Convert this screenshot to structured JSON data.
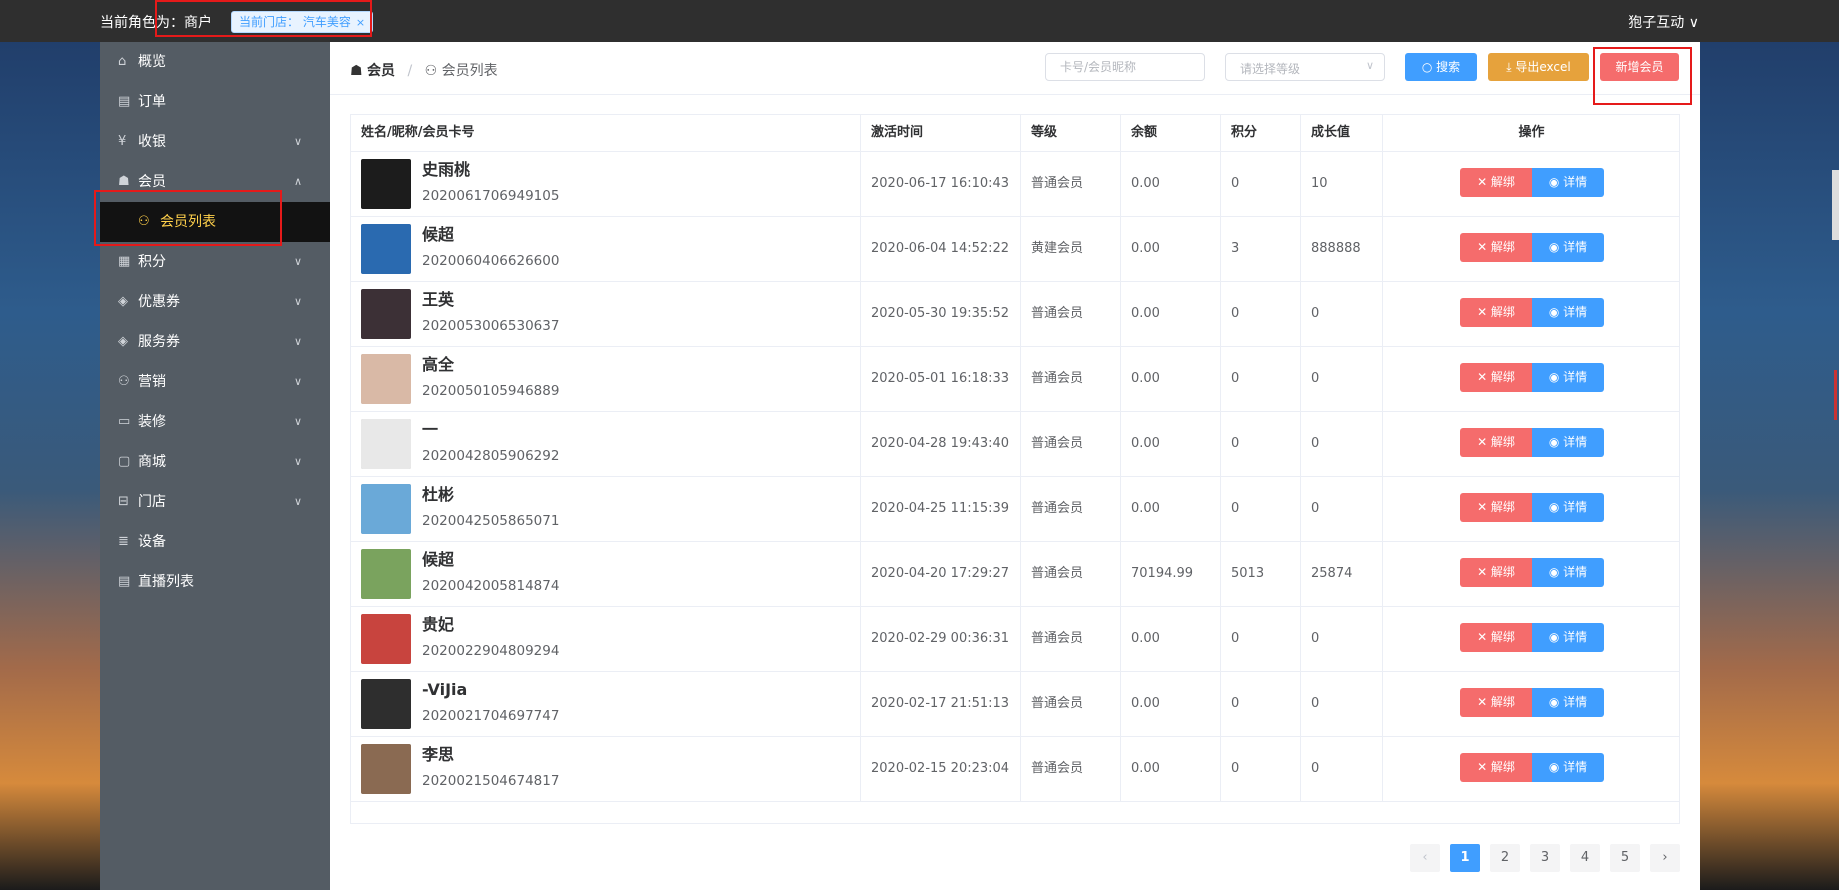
{
  "topbar": {
    "role_text": "当前角色为：商户",
    "store_tag": "当前门店： 汽车美容",
    "store_tag_close": "×",
    "user_menu": "狍子互动 ∨"
  },
  "sidebar": {
    "items": [
      {
        "label": "概览",
        "icon": "⌂",
        "chevron": ""
      },
      {
        "label": "订单",
        "icon": "▤",
        "chevron": ""
      },
      {
        "label": "收银",
        "icon": "¥",
        "chevron": "∨"
      },
      {
        "label": "会员",
        "icon": "☗",
        "chevron": "∧"
      },
      {
        "label": "积分",
        "icon": "▦",
        "chevron": "∨"
      },
      {
        "label": "优惠券",
        "icon": "◈",
        "chevron": "∨"
      },
      {
        "label": "服务券",
        "icon": "◈",
        "chevron": "∨"
      },
      {
        "label": "营销",
        "icon": "⚇",
        "chevron": "∨"
      },
      {
        "label": "装修",
        "icon": "▭",
        "chevron": "∨"
      },
      {
        "label": "商城",
        "icon": "▢",
        "chevron": "∨"
      },
      {
        "label": "门店",
        "icon": "⊟",
        "chevron": "∨"
      },
      {
        "label": "设备",
        "icon": "≣",
        "chevron": ""
      },
      {
        "label": "直播列表",
        "icon": "▤",
        "chevron": ""
      }
    ],
    "sub_item": {
      "label": "会员列表",
      "icon": "⚇"
    }
  },
  "breadcrumb": {
    "level1": "会员",
    "level2": "会员列表",
    "icon1": "☗",
    "icon2": "⚇",
    "separator": "/"
  },
  "search": {
    "card_placeholder": "卡号/会员昵称",
    "level_placeholder": "请选择等级",
    "level_arrow": "∨",
    "search_label": "搜索",
    "export_label": "导出excel",
    "add_label": "新增会员"
  },
  "table": {
    "columns": [
      "姓名/昵称/会员卡号",
      "激活时间",
      "等级",
      "余额",
      "积分",
      "成长值",
      "操作"
    ],
    "rows": [
      {
        "name": "史雨桃",
        "card": "2020061706949105",
        "time": "2020-06-17 16:10:43",
        "level": "普通会员",
        "balance": "0.00",
        "points": "0",
        "growth": "10",
        "avatar_color": "#1c1c1c"
      },
      {
        "name": "候超",
        "card": "2020060406626600",
        "time": "2020-06-04 14:52:22",
        "level": "黄建会员",
        "balance": "0.00",
        "points": "3",
        "growth": "888888",
        "avatar_color": "#2a6ab0"
      },
      {
        "name": "王英",
        "card": "2020053006530637",
        "time": "2020-05-30 19:35:52",
        "level": "普通会员",
        "balance": "0.00",
        "points": "0",
        "growth": "0",
        "avatar_color": "#3c3036"
      },
      {
        "name": "高全",
        "card": "2020050105946889",
        "time": "2020-05-01 16:18:33",
        "level": "普通会员",
        "balance": "0.00",
        "points": "0",
        "growth": "0",
        "avatar_color": "#d9b9a6"
      },
      {
        "name": "一",
        "card": "2020042805906292",
        "time": "2020-04-28 19:43:40",
        "level": "普通会员",
        "balance": "0.00",
        "points": "0",
        "growth": "0",
        "avatar_color": "#e8e8e8"
      },
      {
        "name": "杜彬",
        "card": "2020042505865071",
        "time": "2020-04-25 11:15:39",
        "level": "普通会员",
        "balance": "0.00",
        "points": "0",
        "growth": "0",
        "avatar_color": "#6aa9d8"
      },
      {
        "name": "候超",
        "card": "2020042005814874",
        "time": "2020-04-20 17:29:27",
        "level": "普通会员",
        "balance": "70194.99",
        "points": "5013",
        "growth": "25874",
        "avatar_color": "#7aa35e"
      },
      {
        "name": "贵妃",
        "card": "2020022904809294",
        "time": "2020-02-29 00:36:31",
        "level": "普通会员",
        "balance": "0.00",
        "points": "0",
        "growth": "0",
        "avatar_color": "#c8443e"
      },
      {
        "name": "-ViJia",
        "card": "2020021704697747",
        "time": "2020-02-17 21:51:13",
        "level": "普通会员",
        "balance": "0.00",
        "points": "0",
        "growth": "0",
        "avatar_color": "#2e2e2e"
      },
      {
        "name": "李思",
        "card": "2020021504674817",
        "time": "2020-02-15 20:23:04",
        "level": "普通会员",
        "balance": "0.00",
        "points": "0",
        "growth": "0",
        "avatar_color": "#8a6a52"
      }
    ],
    "unbind_label": "✕ 解绑",
    "detail_label": "◉ 详情"
  },
  "pagination": {
    "prev": "‹",
    "next": "›",
    "pages": [
      "1",
      "2",
      "3",
      "4",
      "5"
    ],
    "current": "1"
  }
}
